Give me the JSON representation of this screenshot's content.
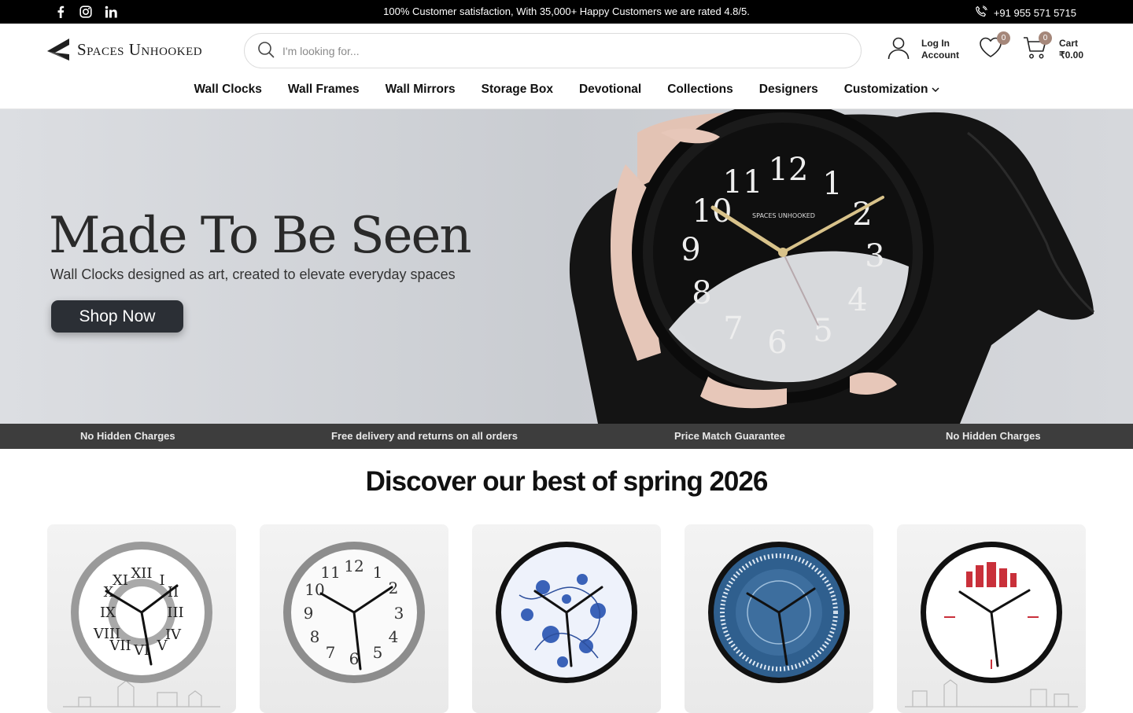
{
  "topbar": {
    "social": [
      "facebook-icon",
      "instagram-icon",
      "linkedin-icon"
    ],
    "announcement": "100% Customer satisfaction, With 35,000+ Happy Customers we are rated 4.8/5.",
    "phone": "+91 955 571 5715"
  },
  "header": {
    "logo_text": "Spaces Unhooked",
    "search_placeholder": "I'm looking for...",
    "account_line1": "Log In",
    "account_line2": "Account",
    "wishlist_count": "0",
    "cart_count": "0",
    "cart_label": "Cart",
    "cart_total": "₹0.00"
  },
  "nav": [
    "Wall Clocks",
    "Wall Frames",
    "Wall Mirrors",
    "Storage Box",
    "Devotional",
    "Collections",
    "Designers",
    "Customization"
  ],
  "hero": {
    "title": "Made To Be Seen",
    "subtitle": "Wall Clocks designed as art, created to elevate everyday spaces",
    "button": "Shop Now",
    "clock_brand": "SPACES UNHOOKED"
  },
  "marquee": [
    "No Hidden Charges",
    "Free delivery and returns on all orders",
    "Price Match Guarantee",
    "No Hidden Charges"
  ],
  "section": {
    "title": "Discover our best of spring 2026"
  },
  "products": [
    {
      "style": "roman-silver"
    },
    {
      "style": "classic-silver"
    },
    {
      "style": "blue-floral"
    },
    {
      "style": "blue-mandala"
    },
    {
      "style": "city-skyline"
    }
  ],
  "colors": {
    "topbar": "#000000",
    "marquee": "#3d3d3d",
    "badge": "#a5877a",
    "hero_button": "#2b2f35"
  }
}
